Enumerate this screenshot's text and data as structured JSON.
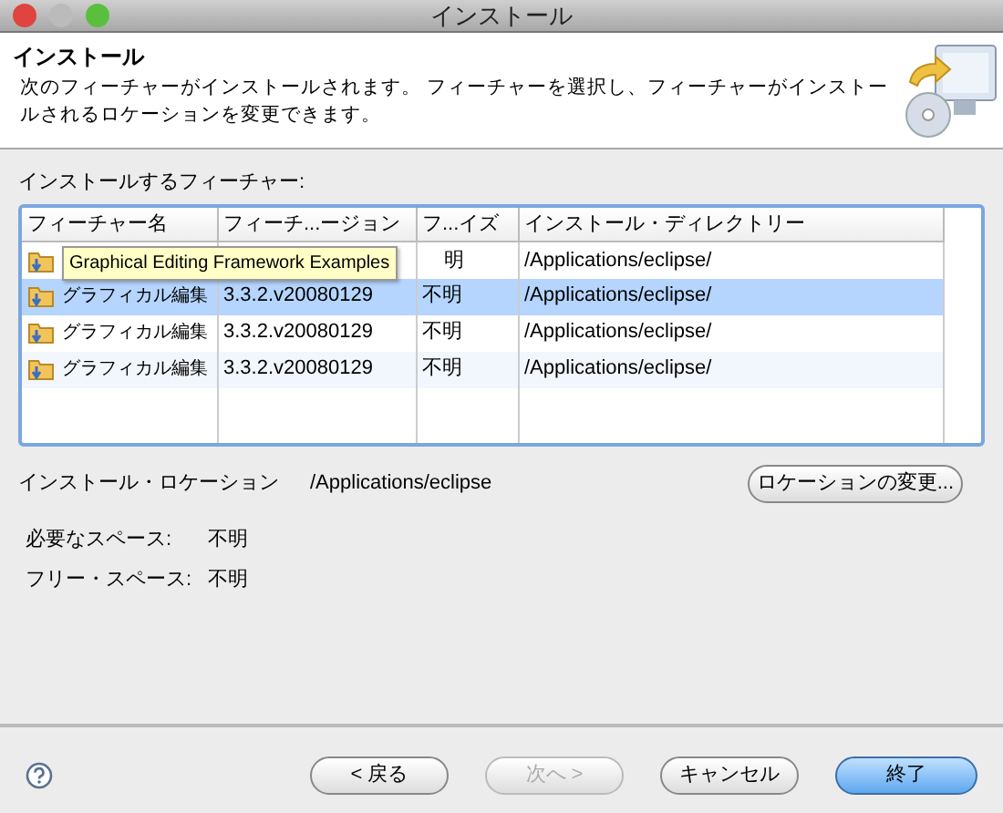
{
  "window": {
    "title": "インストール"
  },
  "header": {
    "title": "インストール",
    "description": "次のフィーチャーがインストールされます。 フィーチャーを選択し、フィーチャーがインストールされるロケーションを変更できます。"
  },
  "features_label": "インストールするフィーチャー:",
  "table": {
    "columns": [
      "フィーチャー名",
      "フィーチ...ージョン",
      "フ...イズ",
      "インストール・ディレクトリー"
    ],
    "rows": [
      {
        "size": "明",
        "directory": "/Applications/eclipse/",
        "selected": false
      },
      {
        "name": "グラフィカル編集",
        "version": "3.3.2.v20080129",
        "size": "不明",
        "directory": "/Applications/eclipse/",
        "selected": true
      },
      {
        "name": "グラフィカル編集",
        "version": "3.3.2.v20080129",
        "size": "不明",
        "directory": "/Applications/eclipse/",
        "selected": false
      },
      {
        "name": "グラフィカル編集",
        "version": "3.3.2.v20080129",
        "size": "不明",
        "directory": "/Applications/eclipse/",
        "selected": false
      }
    ],
    "tooltip": "Graphical Editing Framework Examples"
  },
  "location": {
    "label": "インストール・ロケーション",
    "value": "/Applications/eclipse",
    "button": "ロケーションの変更..."
  },
  "space": [
    {
      "label": "必要なスペース:",
      "value": "不明"
    },
    {
      "label": "フリー・スペース:",
      "value": "不明"
    }
  ],
  "buttons": [
    {
      "label": "< 戻る",
      "disabled": false,
      "default": false
    },
    {
      "label": "次へ >",
      "disabled": true,
      "default": false
    },
    {
      "label": "キャンセル",
      "disabled": false,
      "default": false
    },
    {
      "label": "終了",
      "disabled": false,
      "default": true
    }
  ]
}
